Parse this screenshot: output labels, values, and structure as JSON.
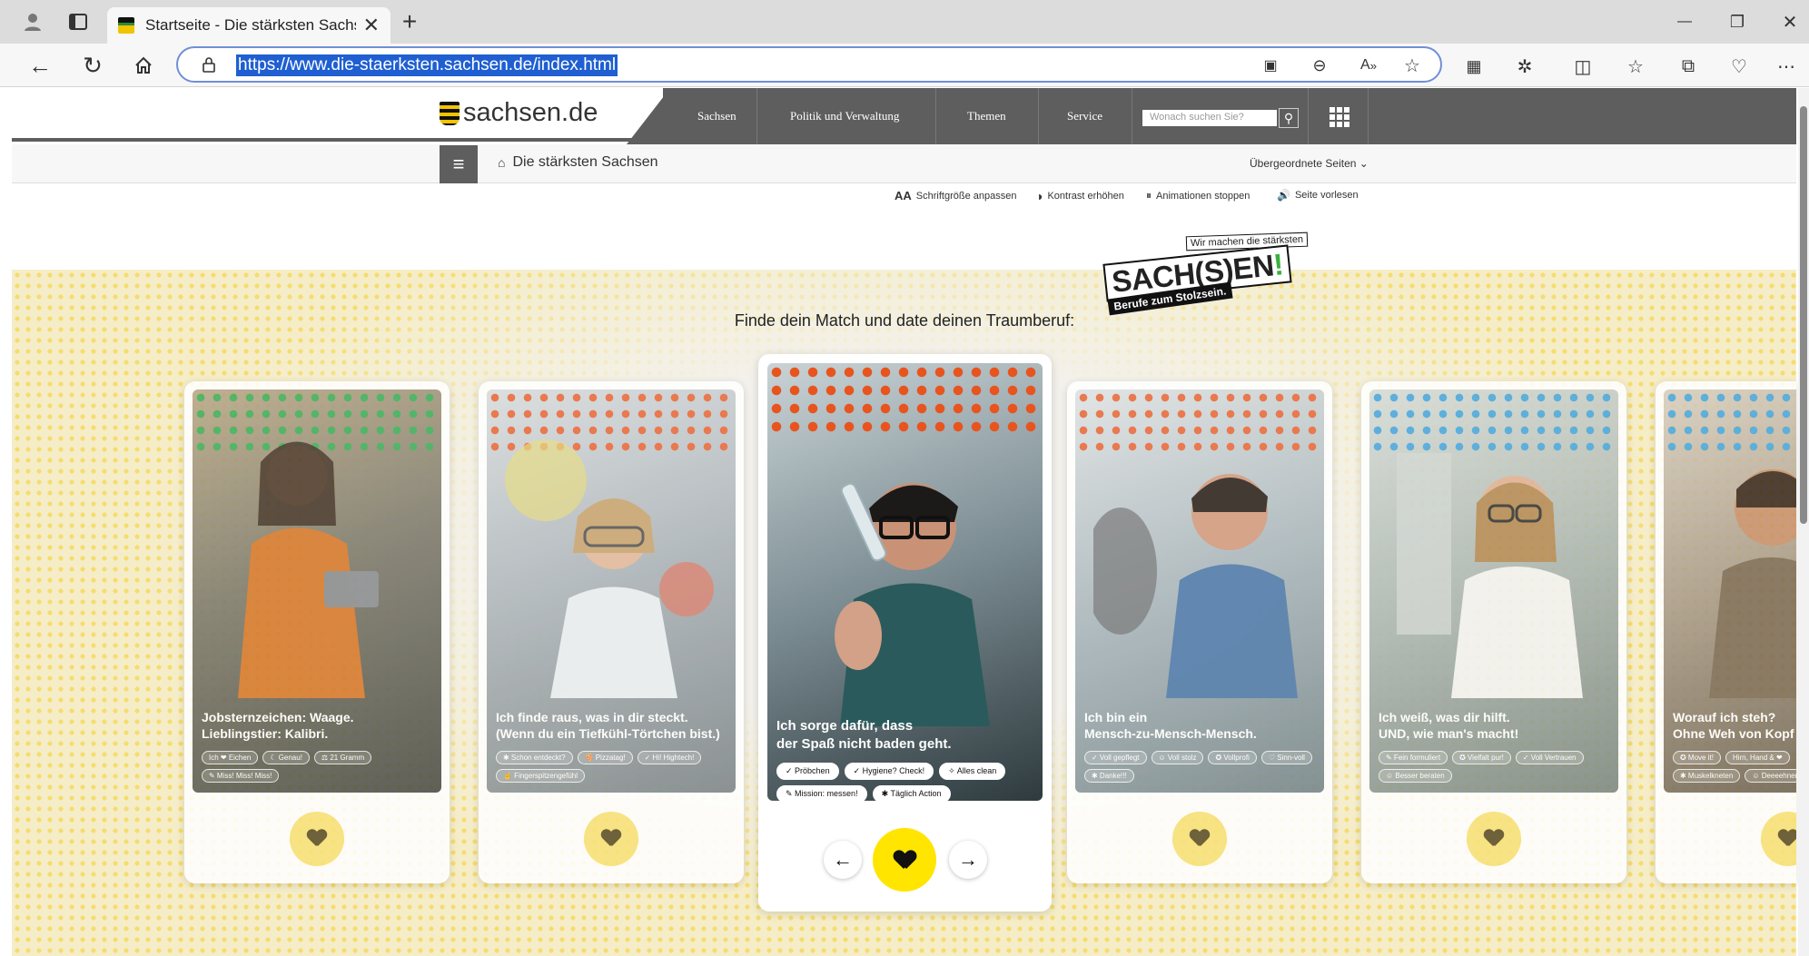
{
  "browser": {
    "tab_title": "Startseite - Die stärksten Sachsen",
    "url": "https://www.die-staerksten.sachsen.de/index.html",
    "new_tab": "+",
    "close_tab": "✕",
    "window_controls": [
      "—",
      "❐",
      "✕"
    ]
  },
  "site": {
    "logo_text": "sachsen.de",
    "nav": [
      "Sachsen",
      "Politik und Verwaltung",
      "Themen",
      "Service"
    ],
    "search_placeholder": "Wonach suchen Sie?",
    "breadcrumb": "Die stärksten Sachsen",
    "parent_pages": "Übergeordnete Seiten ⌄",
    "a11y": [
      {
        "icon": "AA",
        "label": "Schriftgröße anpassen"
      },
      {
        "icon": "◑",
        "label": "Kontrast erhöhen"
      },
      {
        "icon": "⏸",
        "label": "Animationen stoppen"
      },
      {
        "icon": "🔊",
        "label": "Seite vorlesen"
      }
    ]
  },
  "badge": {
    "top": "Wir machen die stärksten",
    "main": "SACH(S)EN",
    "exclaim": "!",
    "sub": "Berufe zum Stolzsein."
  },
  "headline": "Finde dein Match und date deinen Traumberuf:",
  "cards": [
    {
      "caption": [
        "Jobsternzeichen: Waage.",
        "Lieblingstier: Kalibri."
      ],
      "chips": [
        "Ich ❤ Eichen",
        "☾ Genau!",
        "⚖ 21 Gramm",
        "✎ Miss! Miss! Miss!"
      ],
      "accent": "#3fae5b"
    },
    {
      "caption": [
        "Ich finde raus, was in dir steckt.",
        "(Wenn du ein Tiefkühl-Törtchen bist.)"
      ],
      "chips": [
        "✱ Schon entdeckt?",
        "🍕 Pizzatag!",
        "✓ Hi! Hightech!",
        "☝ Fingerspitzengefühl"
      ],
      "accent": "#e8693a"
    },
    {
      "caption": [
        "Ich sorge dafür, dass",
        "der Spaß nicht baden geht."
      ],
      "chips": [
        "✓ Pröbchen",
        "✓ Hygiene? Check!",
        "✧ Alles clean",
        "✎ Mission: messen!",
        "✱ Täglich Action"
      ],
      "accent": "#e8541e"
    },
    {
      "caption": [
        "Ich bin ein",
        "Mensch-zu-Mensch-Mensch."
      ],
      "chips": [
        "✓ Voll gepflegt",
        "☺ Voll stolz",
        "✪ Vollprofi",
        "♡ Sinn-voll",
        "✱ Danke!!!"
      ],
      "accent": "#e8693a"
    },
    {
      "caption": [
        "Ich weiß, was dir hilft.",
        "UND, wie man's macht!"
      ],
      "chips": [
        "✎ Fein formuliert",
        "✪ Vielfalt pur!",
        "✓ Voll Vertrauen",
        "☺ Besser beraten"
      ],
      "accent": "#4aa7de"
    },
    {
      "caption": [
        "Worauf ich steh?",
        "Ohne Weh von Kopf bis Fuß"
      ],
      "chips": [
        "✪ Move it!",
        "Hirn, Hand & ❤",
        "✱ Muskelkneten",
        "☺ Deeeehnen"
      ],
      "accent": "#4aa7de"
    }
  ],
  "controls": {
    "prev": "←",
    "next": "→"
  },
  "colors": {
    "nav_dark": "#5e5e5e",
    "like_active": "#ffe500",
    "like_side": "#f8e27a",
    "url_highlight": "#1f5fd1"
  }
}
